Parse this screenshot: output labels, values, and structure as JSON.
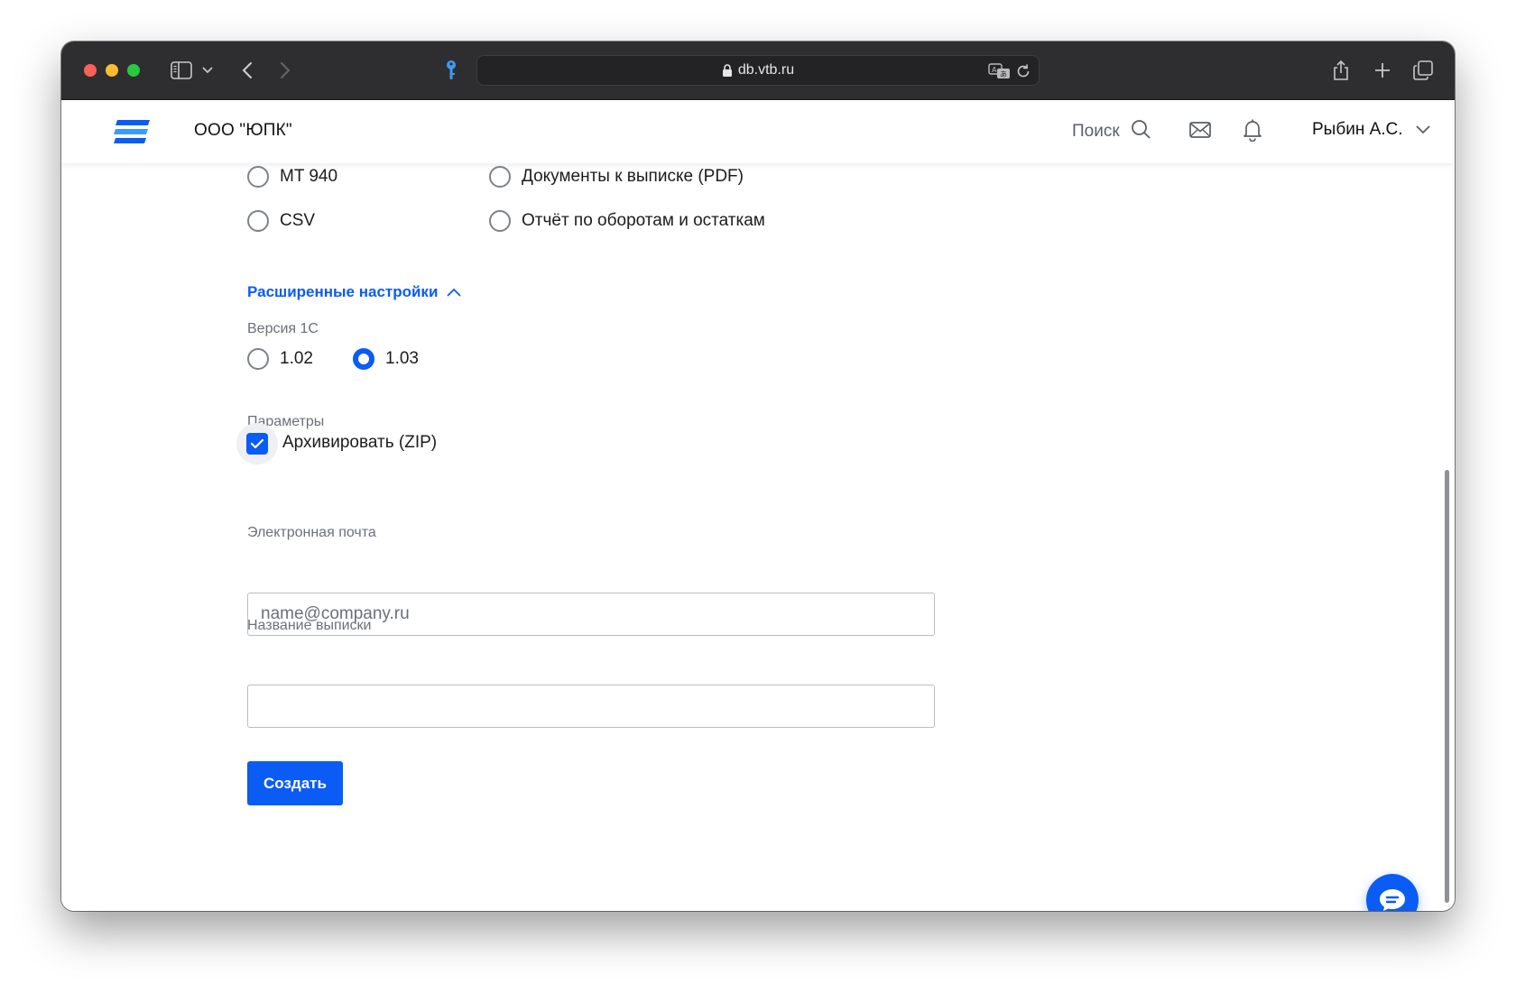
{
  "browser": {
    "url": "db.vtb.ru"
  },
  "header": {
    "company": "ООО \"ЮПК\"",
    "search_label": "Поиск",
    "user_name": "Рыбин А.С."
  },
  "format_options": [
    {
      "label": "MT 940",
      "selected": false
    },
    {
      "label": "CSV",
      "selected": false
    },
    {
      "label": "Документы к выписке (PDF)",
      "selected": false
    },
    {
      "label": "Отчёт по оборотам и остаткам",
      "selected": false
    }
  ],
  "advanced": {
    "toggle_label": "Расширенные настройки",
    "version_label": "Версия 1С",
    "versions": [
      {
        "label": "1.02",
        "selected": false
      },
      {
        "label": "1.03",
        "selected": true
      }
    ],
    "params_label": "Параметры",
    "archive_label": "Архивировать (ZIP)",
    "archive_checked": true
  },
  "form": {
    "email_label": "Электронная почта",
    "email_placeholder": "name@company.ru",
    "email_value": "",
    "name_label": "Название выписки",
    "name_value": "",
    "submit_label": "Создать"
  },
  "colors": {
    "accent": "#0a5cf5",
    "chrome": "#2e2e30"
  }
}
